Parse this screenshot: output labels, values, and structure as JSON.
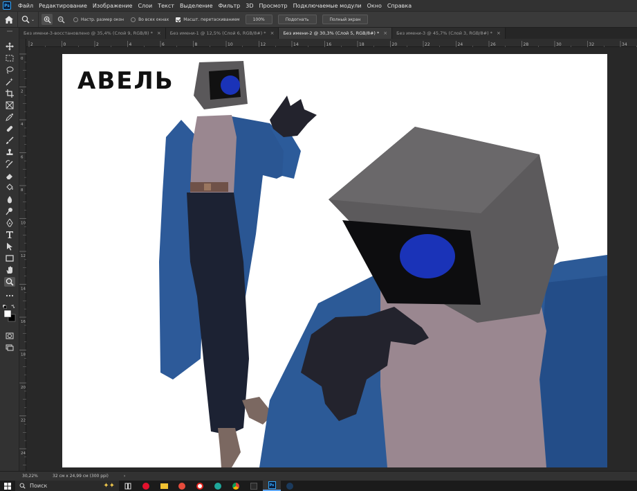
{
  "app": {
    "logo": "Ps"
  },
  "menu": [
    "Файл",
    "Редактирование",
    "Изображение",
    "Слои",
    "Текст",
    "Выделение",
    "Фильтр",
    "3D",
    "Просмотр",
    "Подключаемые модули",
    "Окно",
    "Справка"
  ],
  "options": {
    "resize_windows": "Настр. размер окон",
    "all_windows": "Во всех окнах",
    "scrubby_zoom": "Масшт. перетаскиванием",
    "btn_100": "100%",
    "btn_fit": "Подогнать",
    "btn_fullscreen": "Полный экран"
  },
  "tabs": [
    {
      "label": "Без имени-3-восстановлено @ 35,4% (Слой 9, RGB/8) *",
      "active": false
    },
    {
      "label": "Без имени-1 @ 12,5% (Слой 6, RGB/8#) *",
      "active": false
    },
    {
      "label": "Без имени-2 @ 30,3% (Слой 5, RGB/8#) *",
      "active": true
    },
    {
      "label": "Без имени-3 @ 45,7% (Слой 3, RGB/8#) *",
      "active": false
    }
  ],
  "ruler": {
    "h_labels": [
      "2",
      "0",
      "2",
      "4",
      "6",
      "8",
      "10",
      "12",
      "14",
      "16",
      "18",
      "20",
      "22",
      "24",
      "26",
      "28",
      "30",
      "32",
      "34"
    ],
    "v_labels": [
      "0",
      "2",
      "4",
      "6",
      "8",
      "10",
      "12",
      "14",
      "16",
      "18",
      "20",
      "22",
      "24"
    ]
  },
  "artwork": {
    "title": "АВЕЛЬ"
  },
  "status": {
    "zoom": "30,22%",
    "doc_size": "32 см x 24,99 см (300 ppi)",
    "arrow": "›"
  },
  "taskbar": {
    "search": "Поиск"
  },
  "colors": {
    "accent": "#31a8ff",
    "coat": "#2c5a97",
    "screen_eye": "#1a33b8",
    "skin": "#9a8790",
    "monitor": "#5c5a5c"
  },
  "icons": [
    "home-icon",
    "zoom-icon",
    "zoom-in-icon",
    "zoom-out-icon",
    "move-icon",
    "marquee-icon",
    "lasso-icon",
    "magic-wand-icon",
    "crop-icon",
    "frame-icon",
    "eyedropper-icon",
    "healing-icon",
    "brush-icon",
    "stamp-icon",
    "history-brush-icon",
    "eraser-icon",
    "bucket-icon",
    "blur-icon",
    "dodge-icon",
    "pen-icon",
    "type-icon",
    "path-select-icon",
    "rectangle-icon",
    "hand-icon",
    "zoom-tool-icon",
    "more-tools-icon",
    "color-swatches-icon",
    "quick-mask-icon",
    "screen-mode-icon"
  ]
}
